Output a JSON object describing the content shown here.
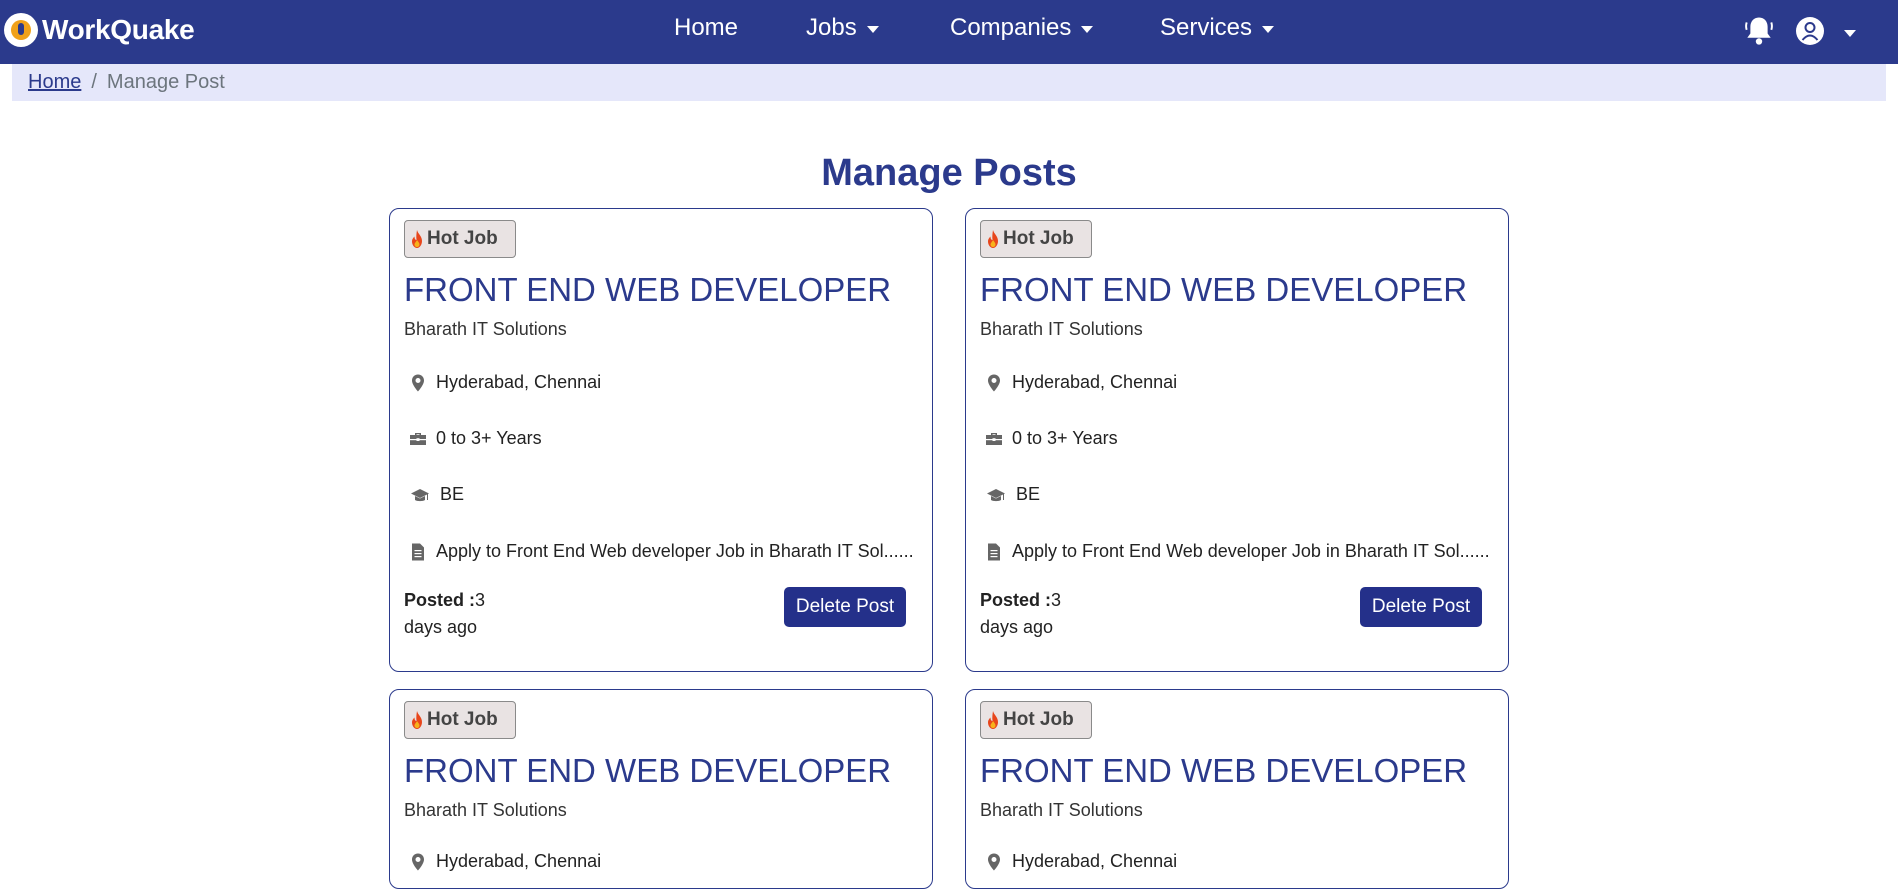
{
  "brand": {
    "name": "WorkQuake"
  },
  "nav": {
    "items": [
      {
        "label": "Home",
        "dropdown": false
      },
      {
        "label": "Jobs",
        "dropdown": true
      },
      {
        "label": "Companies",
        "dropdown": true
      },
      {
        "label": "Services",
        "dropdown": true
      }
    ],
    "icons": [
      "bell-icon",
      "user-avatar-icon",
      "chevron-down-icon"
    ]
  },
  "breadcrumb": {
    "home": "Home",
    "separator": "/",
    "current": "Manage Post"
  },
  "page": {
    "title": "Manage Posts"
  },
  "colors": {
    "primary": "#2b3a8c",
    "breadcrumb_bg": "#e5e7fa",
    "button": "#24308a"
  },
  "cards": [
    {
      "badge": "Hot Job",
      "title": "FRONT END WEB DEVELOPER",
      "company": "Bharath IT Solutions",
      "location": "Hyderabad, Chennai",
      "experience": "0 to 3+ Years",
      "education": "BE",
      "description": "Apply to Front End Web developer Job in Bharath IT Sol......",
      "posted_label": "Posted :",
      "posted_value": "3",
      "posted_suffix": "days ago",
      "delete_label": "Delete Post"
    },
    {
      "badge": "Hot Job",
      "title": "FRONT END WEB DEVELOPER",
      "company": "Bharath IT Solutions",
      "location": "Hyderabad, Chennai",
      "experience": "0 to 3+ Years",
      "education": "BE",
      "description": "Apply to Front End Web developer Job in Bharath IT Sol......",
      "posted_label": "Posted :",
      "posted_value": "3",
      "posted_suffix": "days ago",
      "delete_label": "Delete Post"
    },
    {
      "badge": "Hot Job",
      "title": "FRONT END WEB DEVELOPER",
      "company": "Bharath IT Solutions",
      "location": "Hyderabad, Chennai"
    },
    {
      "badge": "Hot Job",
      "title": "FRONT END WEB DEVELOPER",
      "company": "Bharath IT Solutions",
      "location": "Hyderabad, Chennai"
    }
  ]
}
